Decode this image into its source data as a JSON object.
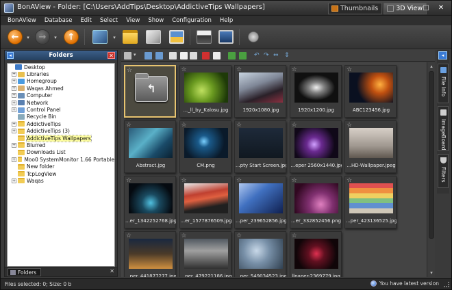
{
  "window": {
    "title": "BonAView - Folder: [C:\\Users\\AddTips\\Desktop\\AddictiveTips Wallpapers]",
    "view_tabs": [
      {
        "label": "Thumbnails",
        "active": false
      },
      {
        "label": "3D View",
        "active": true
      }
    ],
    "controls": {
      "minimize": "–",
      "maximize": "□",
      "close": "✕"
    }
  },
  "menu": [
    "BonAView",
    "Database",
    "Edit",
    "Select",
    "View",
    "Show",
    "Configuration",
    "Help"
  ],
  "toolbar": {
    "buttons": [
      {
        "icon": "back-arrow-icon",
        "glyph": "←"
      },
      {
        "icon": "forward-arrow-icon",
        "glyph": "→"
      },
      {
        "icon": "up-arrow-icon",
        "glyph": "↑"
      },
      {
        "icon": "slideshow-icon",
        "glyph": ""
      },
      {
        "icon": "folder-icon",
        "glyph": ""
      },
      {
        "icon": "edit-image-icon",
        "glyph": ""
      },
      {
        "icon": "picture-icon",
        "glyph": ""
      },
      {
        "icon": "print-icon",
        "glyph": ""
      },
      {
        "icon": "wallpaper-icon",
        "glyph": ""
      },
      {
        "icon": "settings-icon",
        "glyph": ""
      }
    ]
  },
  "folders_panel": {
    "title": "Folders",
    "pin_glyph": "◂",
    "close_glyph": "✕",
    "tree": [
      {
        "label": "Desktop",
        "indent": 0,
        "expander": "",
        "icon": "desk",
        "selected": false
      },
      {
        "label": "Libraries",
        "indent": 1,
        "expander": "+",
        "icon": "lib",
        "selected": false
      },
      {
        "label": "Homegroup",
        "indent": 1,
        "expander": "+",
        "icon": "home",
        "selected": false
      },
      {
        "label": "Waqas Ahmed",
        "indent": 1,
        "expander": "+",
        "icon": "user",
        "selected": false
      },
      {
        "label": "Computer",
        "indent": 1,
        "expander": "+",
        "icon": "comp",
        "selected": false
      },
      {
        "label": "Network",
        "indent": 1,
        "expander": "+",
        "icon": "net",
        "selected": false
      },
      {
        "label": "Control Panel",
        "indent": 1,
        "expander": "+",
        "icon": "cp",
        "selected": false
      },
      {
        "label": "Recycle Bin",
        "indent": 1,
        "expander": "",
        "icon": "bin",
        "selected": false
      },
      {
        "label": "AddictiveTips",
        "indent": 1,
        "expander": "+",
        "icon": "fold",
        "selected": false
      },
      {
        "label": "AddictiveTips (3)",
        "indent": 1,
        "expander": "+",
        "icon": "fold",
        "selected": false
      },
      {
        "label": "AddictiveTips Wallpapers",
        "indent": 1,
        "expander": "",
        "icon": "fold",
        "selected": true
      },
      {
        "label": "Blurred",
        "indent": 1,
        "expander": "+",
        "icon": "fold",
        "selected": false
      },
      {
        "label": "Downloads List",
        "indent": 1,
        "expander": "",
        "icon": "fold",
        "selected": false
      },
      {
        "label": "Moo0 SystemMonitor 1.66 Portable",
        "indent": 1,
        "expander": "+",
        "icon": "fold",
        "selected": false
      },
      {
        "label": "New folder",
        "indent": 1,
        "expander": "",
        "icon": "fold",
        "selected": false
      },
      {
        "label": "TcpLogView",
        "indent": 1,
        "expander": "",
        "icon": "fold",
        "selected": false
      },
      {
        "label": "Waqas",
        "indent": 1,
        "expander": "+",
        "icon": "fold",
        "selected": false
      }
    ],
    "footer_tab": "Folders",
    "footer_close": "✕"
  },
  "thumbnails": [
    {
      "caption": "",
      "star": "☆",
      "bg": "linear-gradient(#6a6a6a,#6a6a6a)",
      "folder": true,
      "selected": true
    },
    {
      "caption": "..._ll_by_Kalosu.jpg",
      "star": "☆",
      "bg": "radial-gradient(circle at 40% 60%, #bfe060 0%, #6a9a20 35%, #1e3a08 80%)",
      "folder": false,
      "selected": false
    },
    {
      "caption": "1920x1080.jpg",
      "star": "☆",
      "bg": "linear-gradient(160deg, #c8d4e0 0%, #808898 40%, #2a2028 70%, #8a3040 100%)",
      "folder": false,
      "selected": false
    },
    {
      "caption": "1920x1200.jpg",
      "star": "☆",
      "bg": "radial-gradient(ellipse at 50% 50%, #f0f0f0 0%, #808080 25%, #101010 60%)",
      "folder": false,
      "selected": false
    },
    {
      "caption": "ABC123456.jpg",
      "star": "☆",
      "bg": "radial-gradient(circle at 70% 40%, #ffb040 0%, #c05010 25%, #0a1020 65%)",
      "folder": false,
      "selected": false
    },
    {
      "caption": "Abstract.jpg",
      "star": "☆",
      "bg": "linear-gradient(135deg, #2a5a78 0%, #5ab0c8 40%, #1a4a68 70%, #0a2030 100%)",
      "folder": false,
      "selected": false
    },
    {
      "caption": "CM.png",
      "star": "☆",
      "bg": "radial-gradient(circle at 45% 45%, #7ad0ff 0%, #1a5a8a 20%, #0a1a2a 70%)",
      "folder": false,
      "selected": false
    },
    {
      "caption": "...pty Start Screen.jpg",
      "star": "☆",
      "bg": "linear-gradient(#1e2a3a, #101820)",
      "folder": false,
      "selected": false
    },
    {
      "caption": "...eper 2560x1440.jpg",
      "star": "☆",
      "bg": "radial-gradient(circle at 45% 55%, #d0a0ff 0%, #6a2a90 25%, #100818 70%)",
      "folder": false,
      "selected": false
    },
    {
      "caption": "...HD-Wallpaper.jpeg",
      "star": "☆",
      "bg": "linear-gradient(#d8d0c8 0%, #a09890 60%, #605850 100%)",
      "folder": false,
      "selected": false
    },
    {
      "caption": "...er_1342252768.jpg",
      "star": "☆",
      "bg": "radial-gradient(circle at 50% 65%, #50c0e0 0%, #1a4a60 30%, #050a10 75%)",
      "folder": false,
      "selected": false
    },
    {
      "caption": "...er_1577876509.jpg",
      "star": "☆",
      "bg": "linear-gradient(170deg, #e8e8e8 0%, #c04030 35%, #e06040 50%, #202020 75%)",
      "folder": false,
      "selected": false
    },
    {
      "caption": "...per_239652856.jpg",
      "star": "☆",
      "bg": "linear-gradient(140deg, #b0c8f0 0%, #4070c0 40%, #102050 100%)",
      "folder": false,
      "selected": false
    },
    {
      "caption": "...er_332852456.png",
      "star": "☆",
      "bg": "radial-gradient(circle at 60% 70%, #e080c0 0%, #803070 35%, #300820 80%)",
      "folder": false,
      "selected": false
    },
    {
      "caption": "...per_423136525.jpg",
      "star": "☆",
      "bg": "linear-gradient(#e05050 0%, #e05050 16%, #f09040 16%, #f09040 33%, #f0d060 33%, #f0d060 50%, #80c080 50%, #80c080 66%, #6090d0 66%, #6090d0 83%, #d0c8b8 83%)",
      "folder": false,
      "selected": false
    },
    {
      "caption": "...per_441877277.jpg",
      "star": "☆",
      "bg": "linear-gradient(#1a2840 0%, #4a3a28 50%, #d09040 100%)",
      "folder": false,
      "selected": false
    },
    {
      "caption": "...per_479221186.jpg",
      "star": "☆",
      "bg": "linear-gradient(#505860 0%, #a0a0a0 40%, #303030 100%)",
      "folder": false,
      "selected": false
    },
    {
      "caption": "...per_549034523.jpg",
      "star": "☆",
      "bg": "radial-gradient(circle at 40% 40%, #c8d8e8 0%, #7890a8 40%, #304050 100%)",
      "folder": false,
      "selected": false
    },
    {
      "caption": "llpaper-2369779.jpg",
      "star": "☆",
      "bg": "radial-gradient(circle at 50% 50%, #e03050 0%, #601020 30%, #100508 75%)",
      "folder": false,
      "selected": false
    }
  ],
  "right_panel": {
    "pin_glyph": "◂",
    "tabs": [
      "File Info",
      "ImageBoard",
      "Filters"
    ]
  },
  "status": {
    "left": "Files selected: 0; Size: 0 b",
    "right": "You have latest version"
  },
  "colors": {
    "accent_selection": "#e8c470",
    "panel_header": "#2f4f78",
    "orange_button": "#e07000",
    "close_red": "#c8322a"
  }
}
